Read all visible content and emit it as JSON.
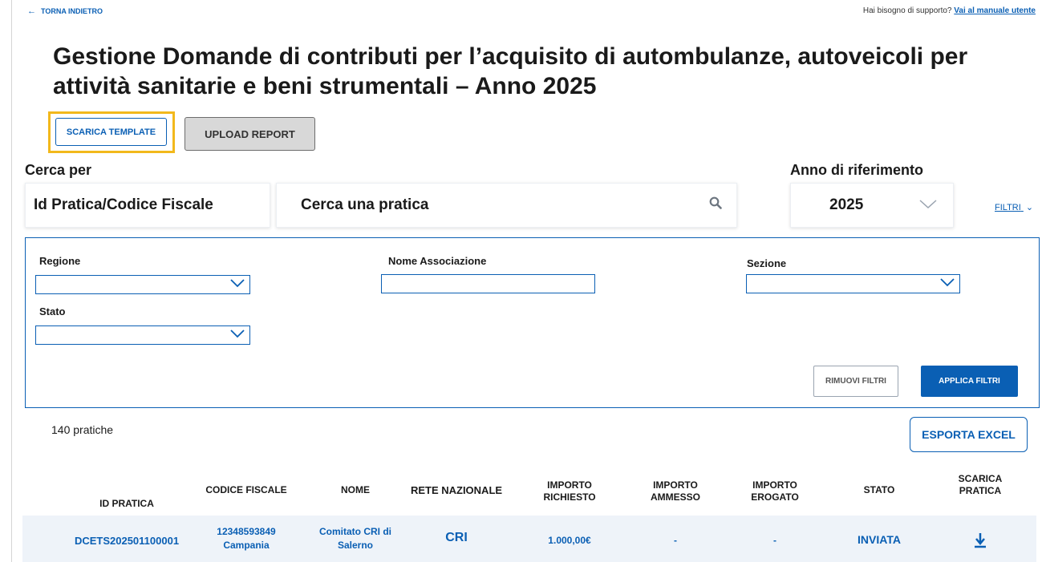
{
  "top": {
    "back_label": "TORNA INDIETRO",
    "help_text": "Hai bisogno di supporto?",
    "help_link": "Vai al manuale utente"
  },
  "page": {
    "title": "Gestione Domande di contributi per l’acquisito di autombulanze, autoveicoli per attività sanitarie e beni strumentali – Anno 2025"
  },
  "actions": {
    "template_label": "SCARICA TEMPLATE",
    "upload_label": "UPLOAD REPORT"
  },
  "search": {
    "search_by_label": "Cerca per",
    "search_by_value": "Id Pratica/Codice Fiscale",
    "placeholder": "Cerca una pratica",
    "year_label": "Anno di riferimento",
    "year_value": "2025",
    "filters_toggle": "FILTRI"
  },
  "filters": {
    "regione_label": "Regione",
    "nome_associazione_label": "Nome Associazione",
    "sezione_label": "Sezione",
    "stato_label": "Stato",
    "remove_label": "RIMUOVI FILTRI",
    "apply_label": "APPLICA FILTRI"
  },
  "results": {
    "count_text": "140 pratiche",
    "export_label": "ESPORTA EXCEL"
  },
  "table": {
    "headers": {
      "id": "ID PRATICA",
      "cf": "CODICE FISCALE",
      "nome": "NOME",
      "rete": "RETE NAZIONALE",
      "imp_rich_1": "IMPORTO",
      "imp_rich_2": "RICHIESTO",
      "imp_amm_1": "IMPORTO",
      "imp_amm_2": "AMMESSO",
      "imp_erog_1": "IMPORTO",
      "imp_erog_2": "EROGATO",
      "stato": "STATO",
      "scarica_1": "SCARICA",
      "scarica_2": "PRATICA"
    },
    "rows": [
      {
        "id": "DCETS202501100001",
        "cf_1": "12348593849",
        "cf_2": "Campania",
        "nome_1": "Comitato CRI di",
        "nome_2": "Salerno",
        "rete": "CRI",
        "importo_richiesto": "1.000,00€",
        "importo_ammesso": "-",
        "importo_erogato": "-",
        "stato": "INVIATA"
      }
    ]
  },
  "colors": {
    "primary": "#0a5fb4",
    "highlight": "#f2b81c",
    "row_bg": "#eef3f9"
  }
}
